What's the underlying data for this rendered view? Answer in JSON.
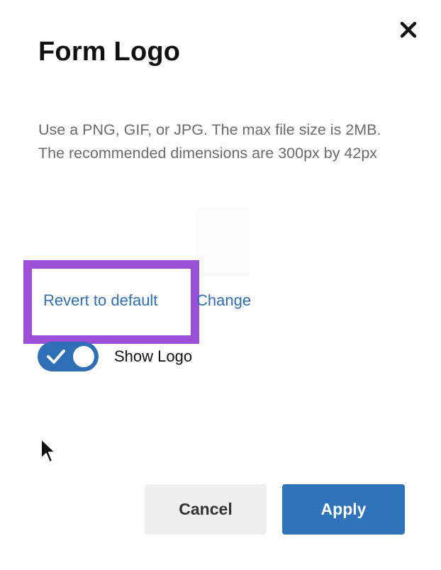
{
  "dialog": {
    "title": "Form Logo",
    "description": "Use a PNG, GIF, or JPG. The max file size is 2MB. The recommended dimensions are 300px by 42px"
  },
  "icons": {
    "close": "close-icon",
    "check": "checkmark-icon",
    "cursor": "mouse-pointer-icon"
  },
  "logo": {
    "revert_label": "Revert to default",
    "change_label": "Change"
  },
  "toggle": {
    "label": "Show Logo",
    "checked": true
  },
  "footer": {
    "cancel_label": "Cancel",
    "apply_label": "Apply"
  },
  "colors": {
    "accent": "#2f6fb6",
    "highlight": "#9b4fd6",
    "cancel_bg": "#efefef",
    "apply_bg": "#2f73bd"
  }
}
